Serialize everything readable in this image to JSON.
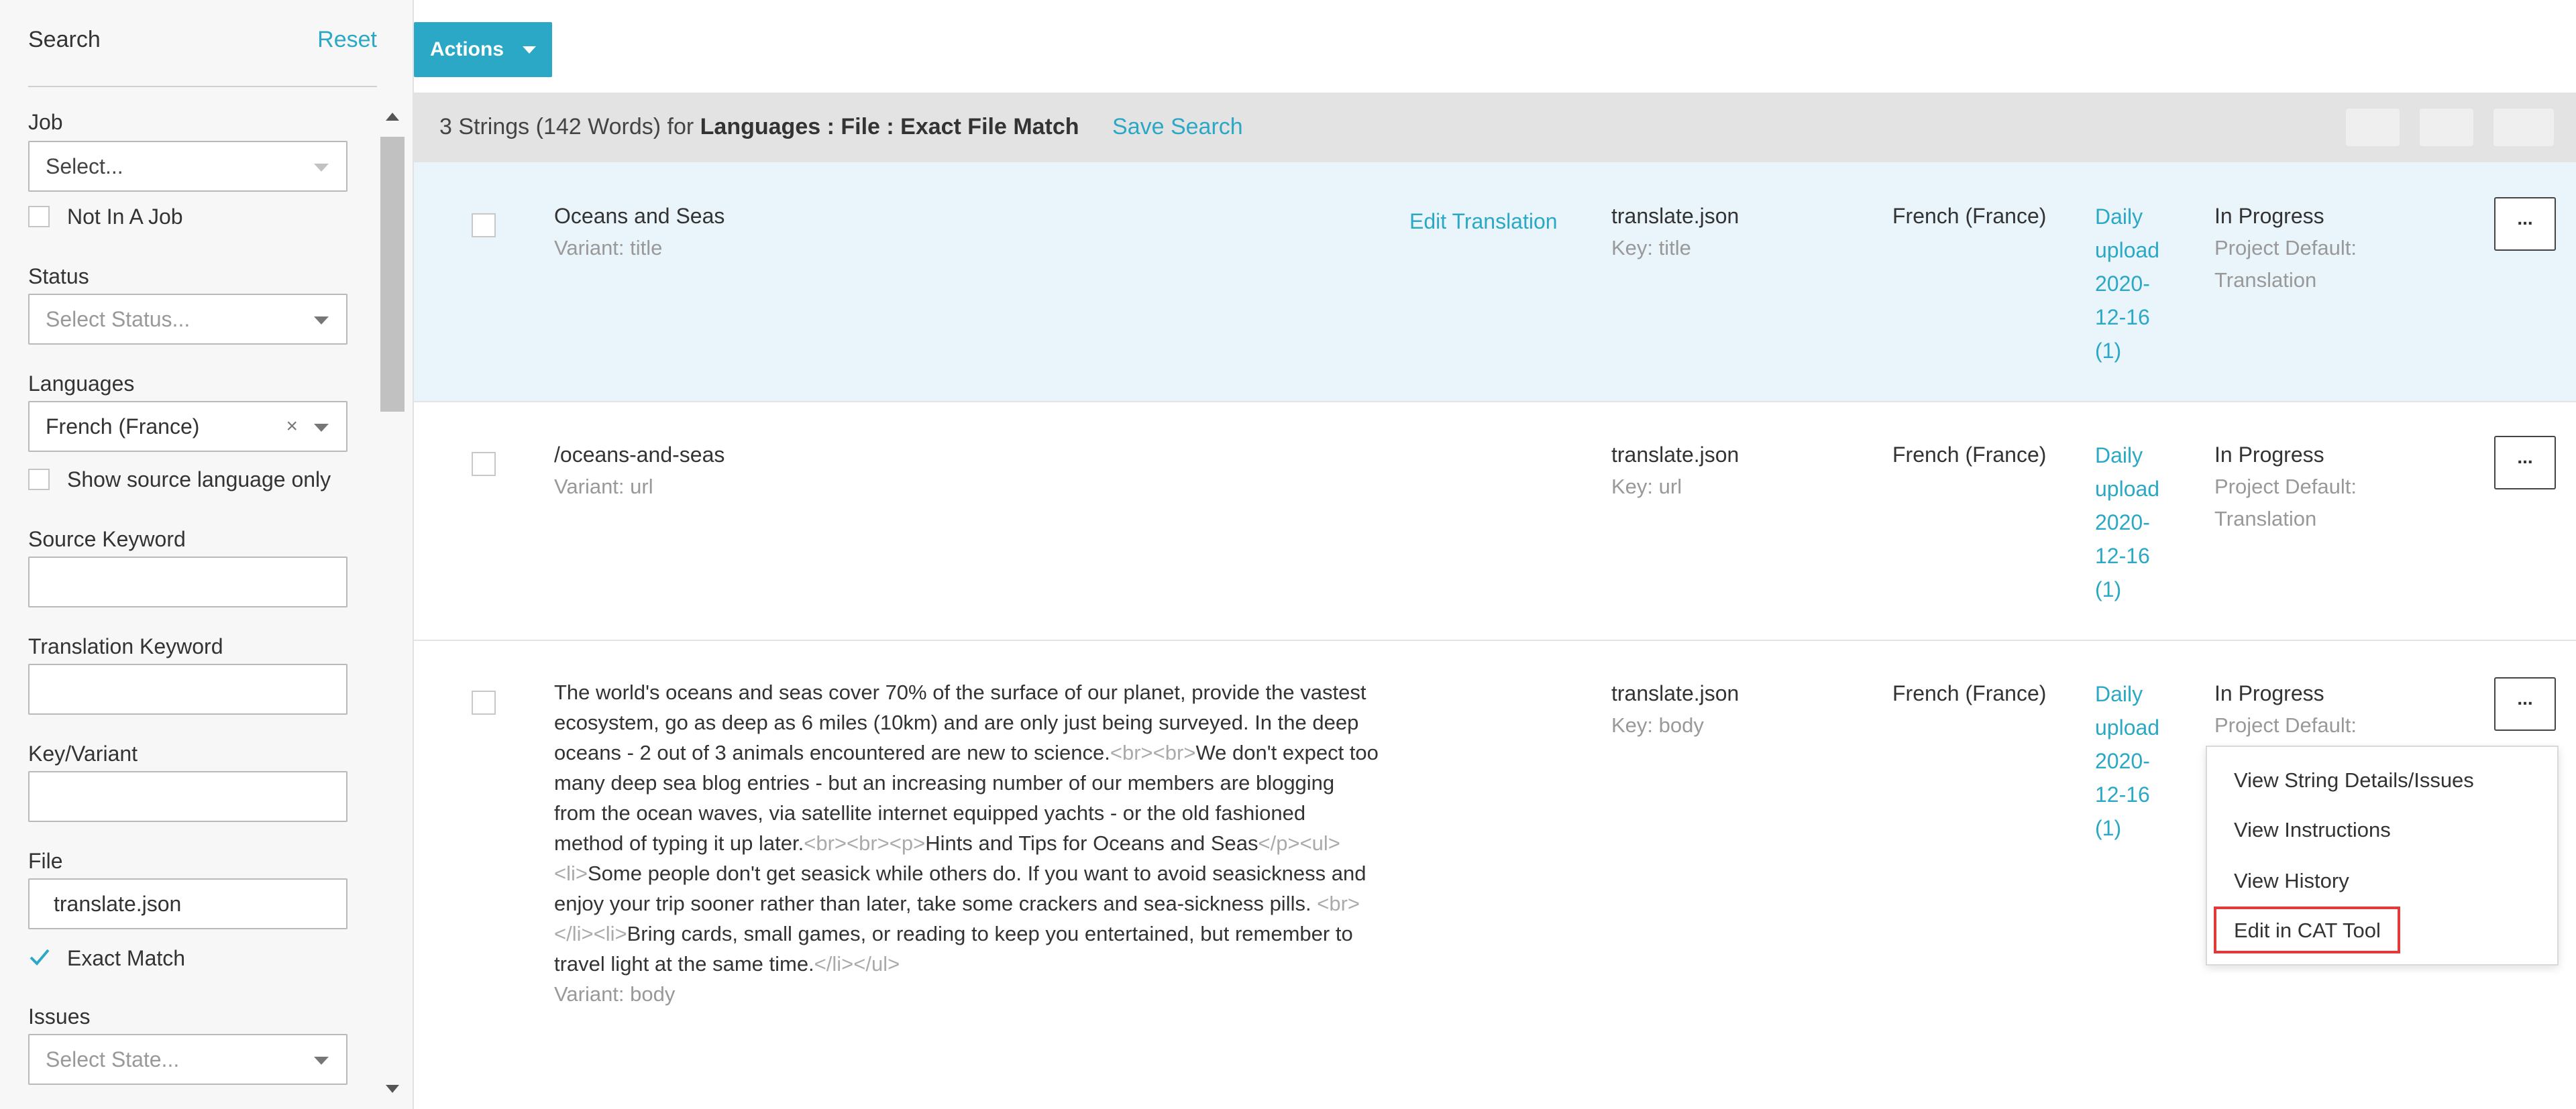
{
  "sidebar": {
    "title": "Search",
    "reset": "Reset",
    "job": {
      "label": "Job",
      "placeholder": "Select...",
      "not_in_job": "Not In A Job"
    },
    "status": {
      "label": "Status",
      "placeholder": "Select Status..."
    },
    "languages": {
      "label": "Languages",
      "value": "French (France)",
      "clear": "×",
      "show_source": "Show source language only"
    },
    "source_keyword": {
      "label": "Source Keyword",
      "value": ""
    },
    "translation_keyword": {
      "label": "Translation Keyword",
      "value": ""
    },
    "key_variant": {
      "label": "Key/Variant",
      "value": ""
    },
    "file": {
      "label": "File",
      "value": "translate.json",
      "exact_match": "Exact Match",
      "exact_match_checked": true
    },
    "issues": {
      "label": "Issues",
      "placeholder": "Select State..."
    }
  },
  "toolbar": {
    "actions_label": "Actions"
  },
  "summary": {
    "count": "3 Strings (142 Words)",
    "for": "for",
    "filter": "Languages : File : Exact File Match",
    "save_search": "Save Search"
  },
  "rows": [
    {
      "source": "Oceans and Seas",
      "variant": "Variant: title",
      "edit": "Edit Translation",
      "file": "translate.json",
      "key": "Key: title",
      "language": "French (France)",
      "job": [
        "Daily",
        "upload",
        "2020-",
        "12-16",
        "(1)"
      ],
      "status": "In Progress",
      "workflow": [
        "Project Default:",
        "Translation"
      ],
      "more": "..."
    },
    {
      "source": "/oceans-and-seas",
      "variant": "Variant: url",
      "file": "translate.json",
      "key": "Key: url",
      "language": "French (France)",
      "job": [
        "Daily",
        "upload",
        "2020-",
        "12-16",
        "(1)"
      ],
      "status": "In Progress",
      "workflow": [
        "Project Default:",
        "Translation"
      ],
      "more": "..."
    },
    {
      "source_parts": [
        "The world's oceans and seas cover 70% of the surface of our planet, provide the vastest ecosystem, go as deep as 6 miles (10km) and are only just being surveyed. In the deep oceans - 2 out of 3 animals encountered are new to science.",
        "<br><br>",
        "We don't expect too many deep sea blog entries - but an increasing number of our members are blogging from the ocean waves, via satellite internet equipped yachts - or the old fashioned method of typing it up later.",
        "<br><br><p>",
        "Hints and Tips for Oceans and Seas",
        "</p><ul><li>",
        "Some people don't get seasick while others do. If you want to avoid seasickness and enjoy your trip sooner rather than later, take some crackers and sea-sickness pills.",
        "<br></li><li>",
        "Bring cards, small games, or reading to keep you entertained, but remember to travel light at the same time.",
        "</li></ul>"
      ],
      "variant": "Variant: body",
      "file": "translate.json",
      "key": "Key: body",
      "language": "French (France)",
      "job": [
        "Daily",
        "upload",
        "2020-",
        "12-16",
        "(1)"
      ],
      "status": "In Progress",
      "workflow": [
        "Project Default:"
      ],
      "more": "..."
    }
  ],
  "menu": {
    "items": [
      "View String Details/Issues",
      "View Instructions",
      "View History",
      "Edit in CAT Tool"
    ],
    "highlight_color": "#e03a3a"
  },
  "colors": {
    "accent": "#2aa8c5",
    "selected_row": "#eaf5fb",
    "summary_bar": "#e3e3e3"
  }
}
